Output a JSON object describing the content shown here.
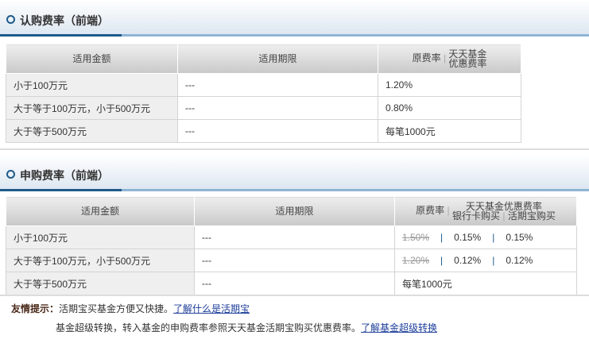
{
  "subscription": {
    "title": "认购费率（前端）",
    "headers": {
      "amount": "适用金额",
      "period": "适用期限",
      "orig": "原费率",
      "disc1": "天天基金",
      "disc2": "优惠费率"
    },
    "rows": [
      {
        "amount": "小于100万元",
        "period": "---",
        "rate": "1.20%"
      },
      {
        "amount": "大于等于100万元，小于500万元",
        "period": "---",
        "rate": "0.80%"
      },
      {
        "amount": "大于等于500万元",
        "period": "---",
        "rate": "每笔1000元"
      }
    ]
  },
  "purchase": {
    "title": "申购费率（前端）",
    "headers": {
      "amount": "适用金额",
      "period": "适用期限",
      "orig": "原费率",
      "disc": "天天基金优惠费率",
      "bank": "银行卡购买",
      "hqb": "活期宝购买"
    },
    "rows": [
      {
        "amount": "小于100万元",
        "period": "---",
        "orig": "1.50%",
        "bank": "0.15%",
        "hqb": "0.15%"
      },
      {
        "amount": "大于等于100万元，小于500万元",
        "period": "---",
        "orig": "1.20%",
        "bank": "0.12%",
        "hqb": "0.12%"
      }
    ],
    "last": {
      "amount": "大于等于500万元",
      "period": "---",
      "rate": "每笔1000元"
    }
  },
  "tips": {
    "label": "友情提示：",
    "line1": "活期宝买基金方便又快捷。",
    "link1": "了解什么是活期宝",
    "line2": "基金超级转换，转入基金的申购费率参照天天基金活期宝购买优惠费率。",
    "link2": "了解基金超级转换"
  }
}
